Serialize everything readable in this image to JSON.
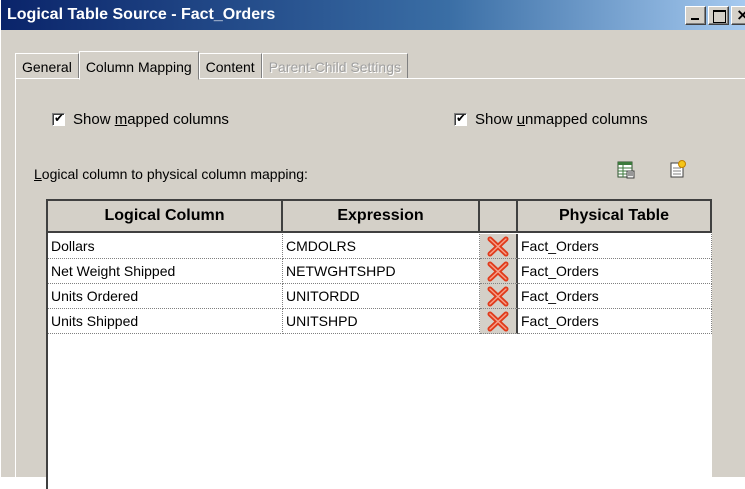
{
  "window": {
    "title": "Logical Table Source - Fact_Orders",
    "buttons": {
      "minimize": "_",
      "maximize": "□",
      "close": "×"
    }
  },
  "tabs": [
    {
      "label": "General",
      "state": "normal"
    },
    {
      "label": "Column Mapping",
      "state": "active"
    },
    {
      "label": "Content",
      "state": "normal"
    },
    {
      "label": "Parent-Child Settings",
      "state": "disabled"
    }
  ],
  "options": {
    "show_mapped": {
      "label_pre": "Show ",
      "label_accel": "m",
      "label_post": "apped columns",
      "checked": true,
      "check_glyph": "✔"
    },
    "show_unmapped": {
      "label_pre": "Show ",
      "label_accel": "u",
      "label_post": "nmapped columns",
      "checked": true,
      "check_glyph": "✔"
    }
  },
  "mapping_label": {
    "accel": "L",
    "rest": "ogical column to physical column mapping:"
  },
  "toolbar_icons": [
    "grid-icon",
    "new-document-icon"
  ],
  "table": {
    "columns": [
      "Logical Column",
      "Expression",
      "",
      "Physical Table"
    ],
    "rows": [
      {
        "logical": "Dollars",
        "expression": "CMDOLRS",
        "physical": "Fact_Orders"
      },
      {
        "logical": "Net Weight Shipped",
        "expression": "NETWGHTSHPD",
        "physical": "Fact_Orders"
      },
      {
        "logical": "Units Ordered",
        "expression": "UNITORDD",
        "physical": "Fact_Orders"
      },
      {
        "logical": "Units Shipped",
        "expression": "UNITSHPD",
        "physical": "Fact_Orders"
      }
    ],
    "delete_icon": "red-x-icon"
  },
  "colors": {
    "title_gradient_start": "#0a246a",
    "title_gradient_end": "#a6caf0",
    "dialog_face": "#d4d0c8",
    "delete_red": "#e03a1a"
  }
}
